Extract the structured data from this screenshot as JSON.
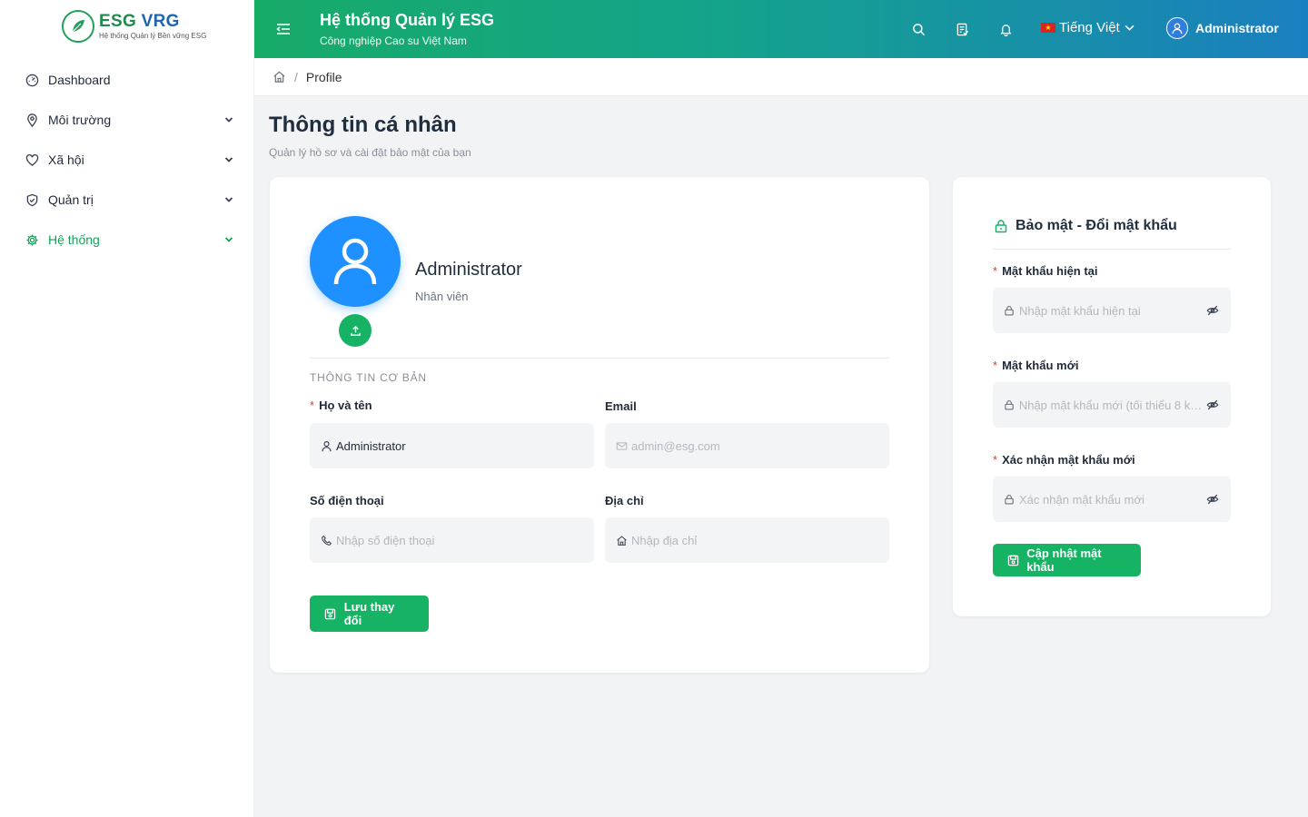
{
  "logo": {
    "title_a": "ESG",
    "title_b": " VRG",
    "subtitle": "Hệ thống Quản lý Bền vững ESG"
  },
  "sidebar": {
    "items": [
      {
        "label": "Dashboard",
        "icon": "dashboard-icon",
        "has_children": false
      },
      {
        "label": "Môi trường",
        "icon": "location-pin-icon",
        "has_children": true
      },
      {
        "label": "Xã hội",
        "icon": "heart-icon",
        "has_children": true
      },
      {
        "label": "Quản trị",
        "icon": "shield-check-icon",
        "has_children": true
      },
      {
        "label": "Hệ thống",
        "icon": "gear-icon",
        "has_children": true,
        "active": true
      }
    ]
  },
  "header": {
    "title": "Hệ thống Quản lý ESG",
    "subtitle": "Công nghiệp Cao su Việt Nam",
    "language": "Tiếng Việt",
    "user": "Administrator"
  },
  "breadcrumb": {
    "current": "Profile"
  },
  "page": {
    "title": "Thông tin cá nhân",
    "subtitle": "Quản lý hồ sơ và cài đặt bảo mật của bạn"
  },
  "profile": {
    "name": "Administrator",
    "role": "Nhân viên",
    "section_label": "THÔNG TIN CƠ BẢN",
    "fields": {
      "fullname": {
        "label": "Họ và tên",
        "required": true,
        "value": "Administrator"
      },
      "email": {
        "label": "Email",
        "placeholder": "admin@esg.com"
      },
      "phone": {
        "label": "Số điện thoại",
        "placeholder": "Nhập số điện thoại"
      },
      "address": {
        "label": "Địa chỉ",
        "placeholder": "Nhập địa chỉ"
      }
    },
    "save_label": "Lưu thay đổi"
  },
  "security": {
    "title": "Bảo mật - Đổi mật khẩu",
    "current": {
      "label": "Mật khẩu hiện tại",
      "placeholder": "Nhập mật khẩu hiện tại"
    },
    "new": {
      "label": "Mật khẩu mới",
      "placeholder": "Nhập mật khẩu mới (tối thiểu 8 ký..."
    },
    "confirm": {
      "label": "Xác nhận mật khẩu mới",
      "placeholder": "Xác nhận mật khẩu mới"
    },
    "submit_label": "Cập nhật mật khẩu"
  },
  "colors": {
    "accent": "#16b364",
    "header_gradient_start": "#17ab68",
    "header_gradient_end": "#1a7fc0",
    "avatar": "#1e90ff"
  }
}
